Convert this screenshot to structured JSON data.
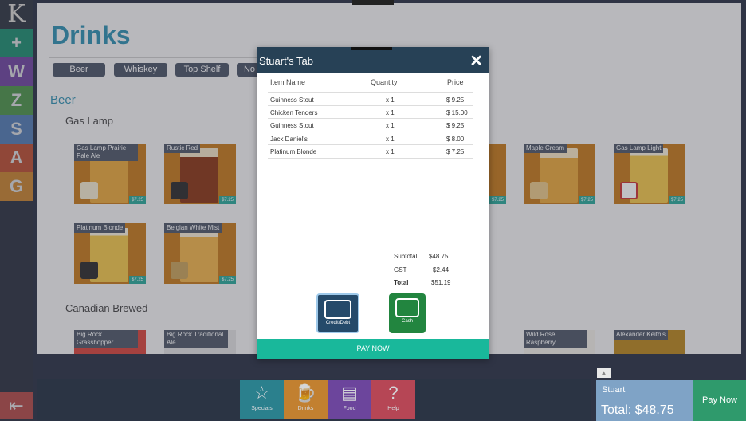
{
  "app": {
    "logo": "K"
  },
  "rail": {
    "items": [
      {
        "label": "+",
        "color": "#1aa07a"
      },
      {
        "label": "W",
        "color": "#7d4ab3"
      },
      {
        "label": "Z",
        "color": "#54a84c"
      },
      {
        "label": "S",
        "color": "#5b8ccc"
      },
      {
        "label": "A",
        "color": "#d9532f"
      },
      {
        "label": "G",
        "color": "#e8942c"
      }
    ],
    "exit_icon": "exit-icon"
  },
  "page": {
    "title": "Drinks",
    "categories": [
      "Beer",
      "Whiskey",
      "Top Shelf",
      "No"
    ],
    "section": "Beer",
    "subsections": [
      "Gas Lamp",
      "Canadian Brewed"
    ]
  },
  "products": [
    {
      "name": "Gas Lamp Prairie Pale Ale",
      "price": "$7.25"
    },
    {
      "name": "Rustic Red",
      "price": "$7.25"
    },
    {
      "name": "Maple Cream",
      "price": "$7.25"
    },
    {
      "name": "Gas Lamp Light",
      "price": "$7.25"
    },
    {
      "name": "Platinum Blonde",
      "price": "$7.25"
    },
    {
      "name": "Belgian White Mist",
      "price": "$7.25"
    },
    {
      "name": "Big Rock Grasshopper",
      "price": ""
    },
    {
      "name": "Big Rock Traditional Ale",
      "price": ""
    },
    {
      "name": "Wild Rose Raspberry",
      "price": ""
    },
    {
      "name": "Alexander Keith's",
      "price": ""
    }
  ],
  "modal": {
    "title": "Stuart's Tab",
    "columns": [
      "Item Name",
      "Quantity",
      "Price"
    ],
    "items": [
      {
        "name": "Guinness Stout",
        "qty": "x 1",
        "price": "$ 9.25"
      },
      {
        "name": "Chicken Tenders",
        "qty": "x 1",
        "price": "$ 15.00"
      },
      {
        "name": "Guinness Stout",
        "qty": "x 1",
        "price": "$ 9.25"
      },
      {
        "name": "Jack Daniel's",
        "qty": "x 1",
        "price": "$ 8.00"
      },
      {
        "name": "Platinum Blonde",
        "qty": "x 1",
        "price": "$ 7.25"
      }
    ],
    "subtotal_label": "Subtotal",
    "subtotal": "$48.75",
    "gst_label": "GST",
    "gst": "$2.44",
    "total_label": "Total",
    "total": "$51.19",
    "credit_label": "Credit/Debt",
    "cash_label": "Cash",
    "pay_label": "PAY NOW"
  },
  "bottom": {
    "nav": [
      {
        "label": "Specials",
        "icon": "star-icon",
        "color": "#2c93a0"
      },
      {
        "label": "Drinks",
        "icon": "beer-icon",
        "color": "#e8942c"
      },
      {
        "label": "Food",
        "icon": "burger-icon",
        "color": "#7d4ab3"
      },
      {
        "label": "Help",
        "icon": "question-icon",
        "color": "#d94b5a"
      }
    ],
    "tab_name": "Stuart",
    "tab_total": "Total: $48.75",
    "pay_now": "Pay Now"
  }
}
